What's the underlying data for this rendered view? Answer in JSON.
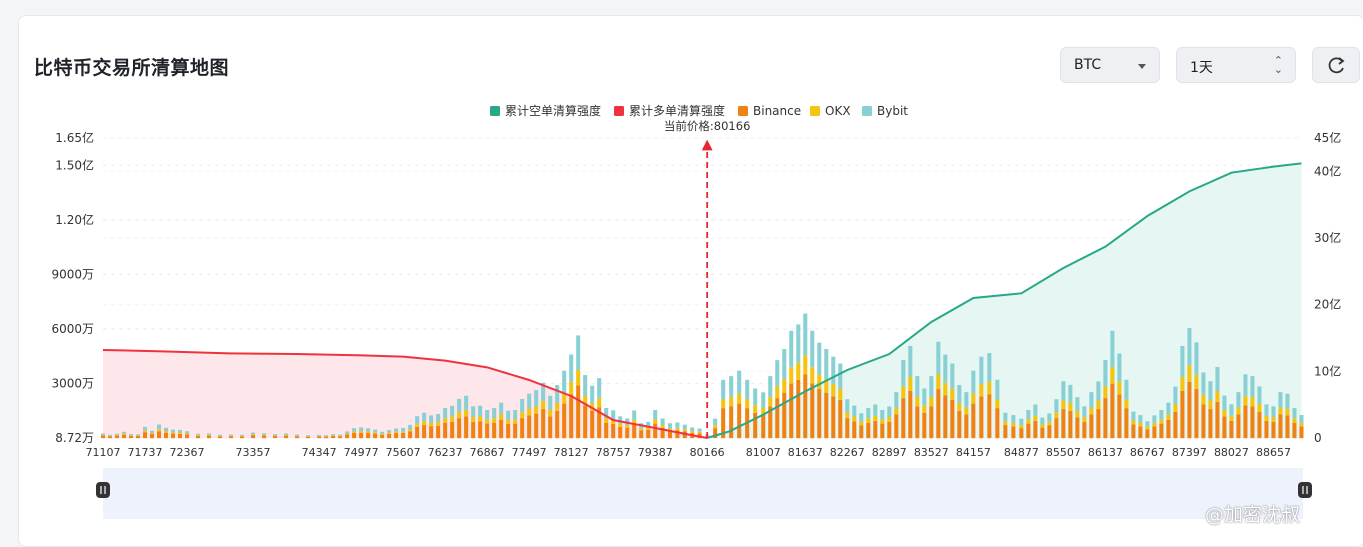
{
  "header": {
    "title": "比特币交易所清算地图",
    "coin_value": "BTC",
    "period_value": "1天",
    "refresh_icon": "refresh-icon"
  },
  "watermark": "@加密沈叔",
  "chart_data": {
    "type": "bar",
    "title": "",
    "legend": {
      "placement": "top-center",
      "items": [
        {
          "name": "累计空单清算强度",
          "color": "#26a889"
        },
        {
          "name": "累计多单清算强度",
          "color": "#f0323e"
        },
        {
          "name": "Binance",
          "color": "#f08113"
        },
        {
          "name": "OKX",
          "color": "#f5c40e"
        },
        {
          "name": "Bybit",
          "color": "#88d0d4"
        }
      ]
    },
    "current_price_label": "当前价格:80166",
    "current_price": 80166,
    "x_tick_labels": [
      "71107",
      "71737",
      "72367",
      "73357",
      "74347",
      "74977",
      "75607",
      "76237",
      "76867",
      "77497",
      "78127",
      "78757",
      "79387",
      "80166",
      "81007",
      "81637",
      "82267",
      "82897",
      "83527",
      "84157",
      "84877",
      "85507",
      "86137",
      "86767",
      "87397",
      "88027",
      "88657"
    ],
    "x_range": [
      71107,
      89100
    ],
    "left_axis": {
      "ticks": [
        {
          "v": 8.72,
          "label": "8.72万"
        },
        {
          "v": 3000,
          "label": "3000万"
        },
        {
          "v": 6000,
          "label": "6000万"
        },
        {
          "v": 9000,
          "label": "9000万"
        },
        {
          "v": 12000,
          "label": "1.20亿"
        },
        {
          "v": 15000,
          "label": "1.50亿"
        },
        {
          "v": 16500,
          "label": "1.65亿"
        }
      ],
      "range": [
        8.72,
        16500
      ],
      "unit": "万"
    },
    "right_axis": {
      "ticks": [
        {
          "v": 0,
          "label": "0"
        },
        {
          "v": 10,
          "label": "10亿"
        },
        {
          "v": 20,
          "label": "20亿"
        },
        {
          "v": 30,
          "label": "30亿"
        },
        {
          "v": 40,
          "label": "40亿"
        },
        {
          "v": 45,
          "label": "45亿"
        }
      ],
      "range": [
        0,
        45
      ],
      "unit": "亿"
    },
    "grid": true,
    "bars": {
      "x": [
        71107,
        71212,
        71317,
        71422,
        71527,
        71632,
        71737,
        71842,
        71947,
        72052,
        72157,
        72262,
        72367,
        72532,
        72697,
        72862,
        73027,
        73192,
        73357,
        73522,
        73687,
        73852,
        74017,
        74182,
        74347,
        74452,
        74557,
        74662,
        74767,
        74872,
        74977,
        75082,
        75187,
        75292,
        75397,
        75502,
        75607,
        75712,
        75817,
        75922,
        76027,
        76132,
        76237,
        76342,
        76447,
        76552,
        76657,
        76762,
        76867,
        76972,
        77077,
        77182,
        77287,
        77392,
        77497,
        77602,
        77707,
        77812,
        77917,
        78022,
        78127,
        78232,
        78337,
        78442,
        78547,
        78652,
        78757,
        78862,
        78967,
        79072,
        79177,
        79282,
        79387,
        79498,
        79609,
        79720,
        79831,
        79942,
        80053,
        80166,
        80286,
        80406,
        80526,
        80646,
        80766,
        80886,
        81007,
        81112,
        81217,
        81322,
        81427,
        81532,
        81637,
        81742,
        81847,
        81952,
        82057,
        82162,
        82267,
        82372,
        82477,
        82582,
        82687,
        82792,
        82897,
        83002,
        83107,
        83212,
        83317,
        83422,
        83527,
        83632,
        83737,
        83842,
        83947,
        84052,
        84157,
        84277,
        84397,
        84517,
        84637,
        84757,
        84877,
        84982,
        85087,
        85192,
        85297,
        85402,
        85507,
        85612,
        85717,
        85822,
        85927,
        86032,
        86137,
        86242,
        86347,
        86452,
        86557,
        86662,
        86767,
        86872,
        86977,
        87082,
        87187,
        87292,
        87397,
        87502,
        87607,
        87712,
        87817,
        87922,
        88027,
        88132,
        88237,
        88342,
        88447,
        88552,
        88657,
        88762,
        88867,
        88972,
        89077
      ],
      "binance": [
        150,
        110,
        140,
        190,
        130,
        120,
        330,
        230,
        380,
        300,
        250,
        240,
        200,
        130,
        140,
        100,
        110,
        100,
        170,
        150,
        120,
        140,
        110,
        90,
        100,
        90,
        120,
        110,
        200,
        290,
        300,
        280,
        250,
        190,
        230,
        280,
        290,
        370,
        620,
        720,
        640,
        680,
        850,
        900,
        1100,
        1200,
        900,
        920,
        800,
        850,
        1000,
        780,
        800,
        1100,
        1250,
        1350,
        1600,
        1200,
        1500,
        1900,
        2400,
        2900,
        1800,
        1500,
        1700,
        850,
        780,
        620,
        560,
        780,
        420,
        460,
        800,
        560,
        420,
        440,
        380,
        300,
        270,
        100,
        550,
        1650,
        1750,
        1900,
        1650,
        1400,
        1300,
        1750,
        2200,
        2500,
        3000,
        3200,
        3500,
        3000,
        2700,
        2500,
        2300,
        2100,
        1100,
        920,
        700,
        850,
        950,
        800,
        900,
        1300,
        2200,
        2600,
        1750,
        1400,
        1750,
        2700,
        2350,
        2100,
        1500,
        1300,
        1900,
        2300,
        2400,
        1650,
        720,
        650,
        550,
        800,
        950,
        580,
        700,
        1100,
        1600,
        1500,
        1150,
        900,
        1300,
        1600,
        2200,
        3000,
        2400,
        1650,
        750,
        650,
        480,
        640,
        800,
        1000,
        1450,
        2600,
        3100,
        2700,
        1850,
        1600,
        2000,
        1200,
        950,
        1300,
        1800,
        1750,
        1450,
        950,
        900,
        1300,
        1250,
        850,
        650,
        700,
        550,
        450,
        300,
        350,
        150
      ],
      "okx": [
        30,
        20,
        30,
        60,
        30,
        30,
        90,
        60,
        110,
        90,
        70,
        70,
        60,
        40,
        40,
        30,
        30,
        30,
        50,
        40,
        30,
        40,
        30,
        20,
        30,
        20,
        30,
        30,
        50,
        80,
        90,
        80,
        70,
        50,
        70,
        80,
        70,
        100,
        170,
        210,
        190,
        200,
        250,
        280,
        330,
        350,
        260,
        270,
        230,
        250,
        300,
        220,
        230,
        330,
        380,
        400,
        450,
        350,
        440,
        560,
        700,
        850,
        520,
        430,
        500,
        250,
        230,
        180,
        160,
        230,
        120,
        140,
        230,
        160,
        120,
        130,
        110,
        90,
        80,
        30,
        160,
        480,
        510,
        560,
        480,
        410,
        380,
        510,
        640,
        750,
        900,
        950,
        1050,
        900,
        800,
        750,
        680,
        620,
        320,
        270,
        210,
        250,
        280,
        230,
        260,
        380,
        650,
        770,
        510,
        410,
        510,
        800,
        690,
        620,
        440,
        380,
        560,
        680,
        700,
        480,
        210,
        190,
        160,
        230,
        280,
        170,
        200,
        320,
        470,
        440,
        340,
        260,
        380,
        470,
        650,
        900,
        700,
        480,
        220,
        190,
        140,
        190,
        230,
        290,
        430,
        770,
        900,
        790,
        540,
        470,
        590,
        350,
        280,
        380,
        530,
        510,
        430,
        280,
        260,
        380,
        370,
        250,
        190,
        210,
        160,
        130,
        90,
        100,
        40
      ],
      "bybit": [
        80,
        60,
        70,
        100,
        70,
        60,
        200,
        120,
        260,
        180,
        150,
        140,
        120,
        70,
        80,
        60,
        60,
        60,
        90,
        80,
        70,
        80,
        60,
        50,
        50,
        50,
        70,
        60,
        120,
        180,
        200,
        180,
        150,
        110,
        140,
        170,
        200,
        260,
        420,
        470,
        420,
        450,
        560,
        600,
        730,
        780,
        590,
        600,
        520,
        560,
        650,
        510,
        520,
        720,
        820,
        890,
        1000,
        780,
        980,
        1250,
        1500,
        1900,
        1150,
        950,
        1100,
        560,
        520,
        400,
        360,
        510,
        280,
        300,
        520,
        360,
        280,
        290,
        250,
        200,
        180,
        60,
        360,
        1080,
        1150,
        1250,
        1080,
        920,
        840,
        1150,
        1450,
        1650,
        2000,
        2100,
        2300,
        2000,
        1750,
        1650,
        1500,
        1380,
        720,
        600,
        460,
        560,
        620,
        520,
        580,
        850,
        1450,
        1700,
        1150,
        920,
        1150,
        1800,
        1550,
        1380,
        980,
        850,
        1250,
        1500,
        1580,
        1080,
        470,
        430,
        360,
        520,
        620,
        380,
        460,
        720,
        1060,
        990,
        760,
        590,
        850,
        1050,
        1450,
        2000,
        1550,
        1080,
        490,
        430,
        310,
        420,
        520,
        660,
        960,
        1700,
        2050,
        1780,
        1220,
        1060,
        1320,
        790,
        630,
        850,
        1180,
        1150,
        960,
        630,
        590,
        850,
        820,
        560,
        430,
        460,
        360,
        300,
        200,
        230,
        100
      ],
      "note": "Bar heights in 万; values estimated from the chart."
    },
    "long_cumulative": {
      "unit": "亿",
      "points": [
        [
          71107,
          13.2
        ],
        [
          72000,
          13.0
        ],
        [
          73000,
          12.7
        ],
        [
          74000,
          12.6
        ],
        [
          75000,
          12.4
        ],
        [
          75607,
          12.2
        ],
        [
          76237,
          11.6
        ],
        [
          76867,
          10.6
        ],
        [
          77497,
          8.7
        ],
        [
          78127,
          6.3
        ],
        [
          78757,
          2.7
        ],
        [
          79387,
          1.5
        ],
        [
          80000,
          0.3
        ],
        [
          80166,
          0.0
        ]
      ]
    },
    "short_cumulative": {
      "unit": "亿",
      "points": [
        [
          80166,
          0.0
        ],
        [
          80500,
          1.0
        ],
        [
          81007,
          3.5
        ],
        [
          81637,
          7.0
        ],
        [
          82267,
          10.2
        ],
        [
          82897,
          12.6
        ],
        [
          83527,
          17.4
        ],
        [
          84157,
          21.0
        ],
        [
          84877,
          21.7
        ],
        [
          85507,
          25.5
        ],
        [
          86137,
          28.7
        ],
        [
          86767,
          33.3
        ],
        [
          87397,
          37.0
        ],
        [
          88027,
          39.8
        ],
        [
          88657,
          40.7
        ],
        [
          89077,
          41.2
        ]
      ]
    },
    "annotations": [
      {
        "text": "当前价格:80166",
        "x": 80166
      }
    ]
  }
}
